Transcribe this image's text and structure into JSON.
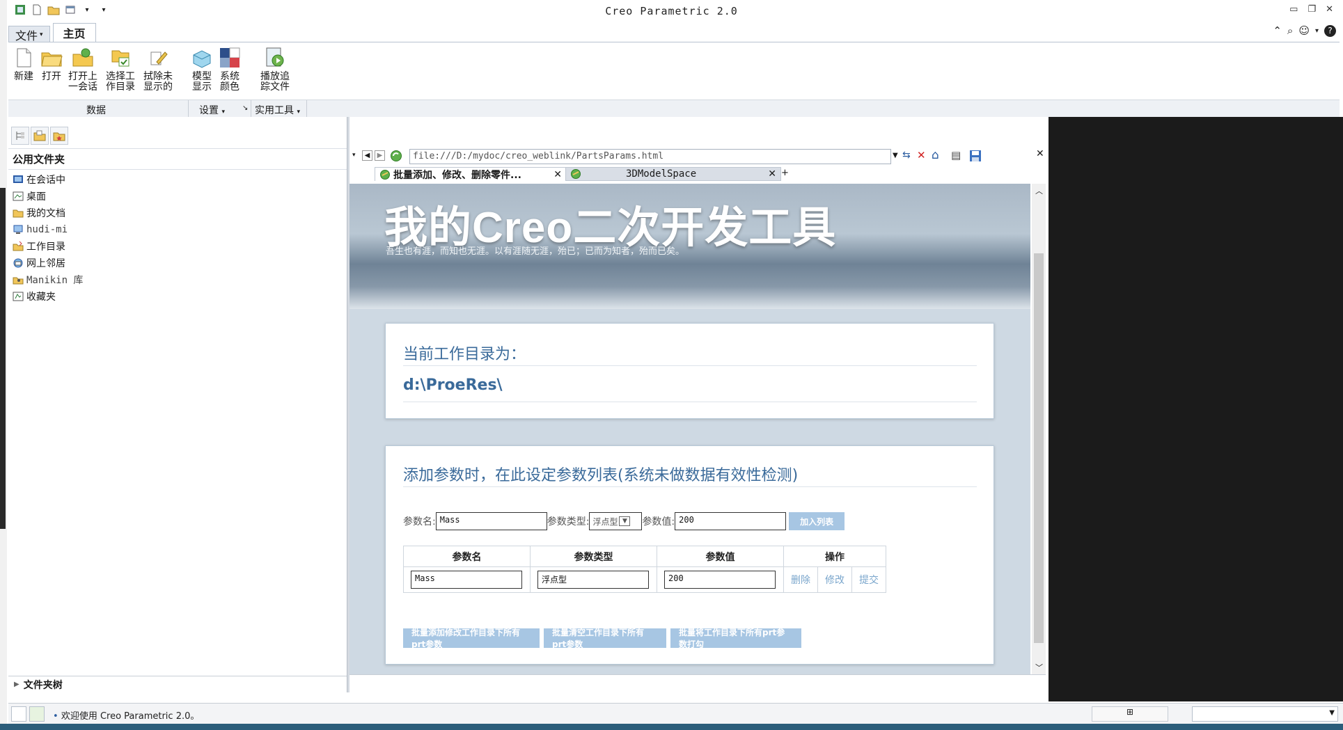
{
  "window": {
    "title": "Creo Parametric 2.0"
  },
  "ribbon": {
    "tabs": [
      {
        "label": "文件"
      },
      {
        "label": "主页"
      }
    ],
    "buttons": [
      {
        "line1": "新建",
        "line2": ""
      },
      {
        "line1": "打开",
        "line2": ""
      },
      {
        "line1": "打开上",
        "line2": "一会话"
      },
      {
        "line1": "选择工",
        "line2": "作目录"
      },
      {
        "line1": "拭除未",
        "line2": "显示的"
      },
      {
        "line1": "模型",
        "line2": "显示"
      },
      {
        "line1": "系统",
        "line2": "颜色"
      },
      {
        "line1": "播放追",
        "line2": "踪文件"
      }
    ],
    "groups": {
      "data": "数据",
      "settings": "设置",
      "utilities": "实用工具"
    }
  },
  "navigator": {
    "header": "公用文件夹",
    "items": [
      {
        "label": "在会话中"
      },
      {
        "label": "桌面"
      },
      {
        "label": "我的文档"
      },
      {
        "label": "hudi-mi"
      },
      {
        "label": "工作目录"
      },
      {
        "label": "网上邻居"
      },
      {
        "label": "Manikin 库"
      },
      {
        "label": "收藏夹"
      }
    ],
    "footer": "文件夹树"
  },
  "browser": {
    "address": "file:///D:/mydoc/creo_weblink/PartsParams.html",
    "tabs": [
      {
        "label": "批量添加、修改、删除零件..."
      },
      {
        "label": "3DModelSpace"
      }
    ]
  },
  "page": {
    "header_title": "我的Creo二次开发工具",
    "header_subtitle": "吾生也有涯，而知也无涯。以有涯随无涯，殆已；已而为知者，殆而已矣。",
    "workdir_title": "当前工作目录为：",
    "workdir_value": "d:\\ProeRes\\",
    "params_title": "添加参数时，在此设定参数列表(系统未做数据有效性检测)",
    "form": {
      "name_label": "参数名:",
      "name_value": "Mass",
      "type_label": "参数类型:",
      "type_value": "浮点型",
      "value_label": "参数值:",
      "value_value": "200",
      "add_button": "加入列表"
    },
    "table": {
      "headers": [
        "参数名",
        "参数类型",
        "参数值",
        "操作"
      ],
      "rows": [
        {
          "name": "Mass",
          "type": "浮点型",
          "value": "200",
          "ops": [
            "删除",
            "修改",
            "提交"
          ]
        }
      ]
    },
    "batch_buttons": [
      "批量添加修改工作目录下所有prt参数",
      "批量清空工作目录下所有prt参数",
      "批量将工作目录下所有prt参数打勾"
    ]
  },
  "status": {
    "message": "欢迎使用 Creo Parametric 2.0。"
  }
}
